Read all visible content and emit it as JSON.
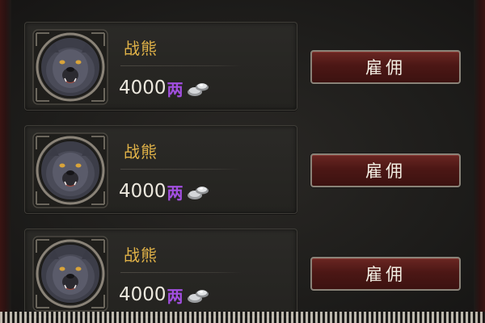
{
  "mercenaries": [
    {
      "name": "战熊",
      "price": "4000",
      "currency": "两",
      "currency_icon": "silver-ingot-icon",
      "action": "雇佣"
    },
    {
      "name": "战熊",
      "price": "4000",
      "currency": "两",
      "currency_icon": "silver-ingot-icon",
      "action": "雇佣"
    },
    {
      "name": "战熊",
      "price": "4000",
      "currency": "两",
      "currency_icon": "silver-ingot-icon",
      "action": "雇佣"
    }
  ],
  "colors": {
    "name": "#e0b248",
    "price": "#ece8de",
    "currency": "#a24fe0",
    "button_bg": "#4c1715",
    "button_text": "#f3efe4"
  }
}
